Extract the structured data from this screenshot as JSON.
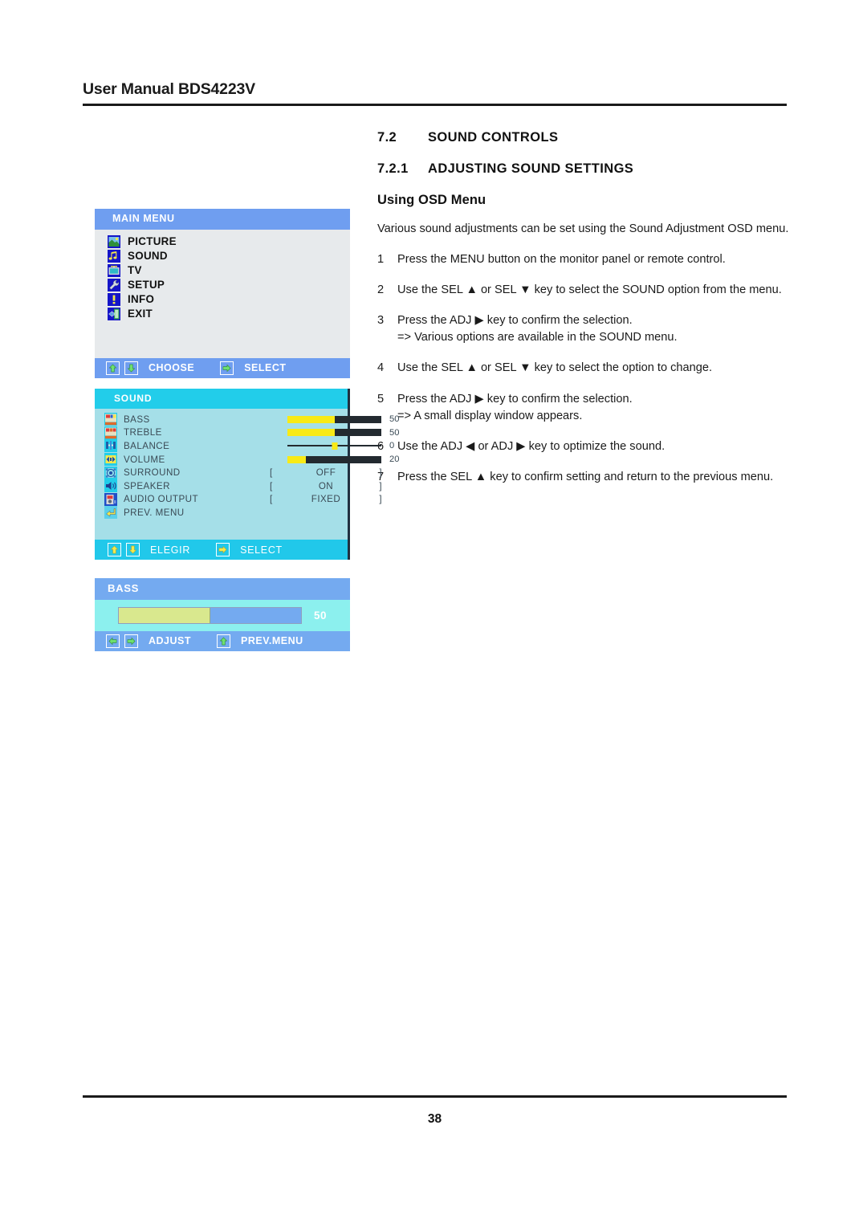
{
  "header": {
    "title": "User Manual BDS4223V"
  },
  "sections": {
    "s72_num": "7.2",
    "s72_title": "SOUND CONTROLS",
    "s721_num": "7.2.1",
    "s721_title": "ADJUSTING SOUND SETTINGS",
    "subhead": "Using OSD Menu",
    "intro": "Various sound adjustments can be set using the Sound Adjustment OSD menu."
  },
  "steps": [
    {
      "num": "1",
      "text": "Press the MENU button on the monitor panel or remote control.",
      "sub": ""
    },
    {
      "num": "2",
      "text": "Use the SEL ▲ or SEL ▼ key to select the SOUND option from the menu.",
      "sub": ""
    },
    {
      "num": "3",
      "text": "Press the ADJ ▶ key to confirm the selection.",
      "sub": "=> Various options are available in the SOUND menu."
    },
    {
      "num": "4",
      "text": "Use the SEL ▲ or SEL ▼ key to select the option to change.",
      "sub": ""
    },
    {
      "num": "5",
      "text": "Press the ADJ ▶ key to confirm the selection.",
      "sub": "=> A small display window appears."
    },
    {
      "num": "6",
      "text": "Use the ADJ ◀ or ADJ ▶  key to optimize the sound.",
      "sub": ""
    },
    {
      "num": "7",
      "text": "Press the SEL ▲ key to confirm setting and return to the previous menu.",
      "sub": ""
    }
  ],
  "main_menu": {
    "title": "MAIN  MENU",
    "items": [
      {
        "label": "PICTURE",
        "icon": "picture-icon"
      },
      {
        "label": "SOUND",
        "icon": "sound-icon"
      },
      {
        "label": "TV",
        "icon": "tv-icon"
      },
      {
        "label": "SETUP",
        "icon": "setup-wrench-icon"
      },
      {
        "label": "INFO",
        "icon": "info-icon"
      },
      {
        "label": "EXIT",
        "icon": "exit-icon"
      }
    ],
    "footer": {
      "choose": "CHOOSE",
      "select": "SELECT"
    }
  },
  "sound_menu": {
    "title": "SOUND",
    "rows": [
      {
        "label": "BASS",
        "icon": "bass-icon",
        "type": "bar",
        "value": "50",
        "percent": 50
      },
      {
        "label": "TREBLE",
        "icon": "treble-icon",
        "type": "bar",
        "value": "50",
        "percent": 50
      },
      {
        "label": "BALANCE",
        "icon": "balance-icon",
        "type": "line",
        "value": "0",
        "percent": 50
      },
      {
        "label": "VOLUME",
        "icon": "volume-icon",
        "type": "bar",
        "value": "20",
        "percent": 20
      },
      {
        "label": "SURROUND",
        "icon": "surround-icon",
        "type": "option",
        "value": "OFF"
      },
      {
        "label": "SPEAKER",
        "icon": "speaker-icon",
        "type": "option",
        "value": "ON"
      },
      {
        "label": "AUDIO OUTPUT",
        "icon": "audio-output-icon",
        "type": "option",
        "value": "FIXED"
      },
      {
        "label": "PREV. MENU",
        "icon": "prev-menu-icon",
        "type": "none",
        "value": ""
      }
    ],
    "bracket_left": "[",
    "bracket_right": "]",
    "footer": {
      "choose": "ELEGIR",
      "select": "SELECT"
    }
  },
  "bass_menu": {
    "title": "BASS",
    "value": "50",
    "percent": 50,
    "footer": {
      "adjust": "ADJUST",
      "prev": "PREV.MENU"
    }
  },
  "footer": {
    "page_number": "38"
  },
  "colors": {
    "mm_bar": "#6f9ef0",
    "mm_body": "#e7eaec",
    "sound_bar": "#22cdea",
    "sound_body": "#a5dfe8",
    "bass_bar": "#74aaf0",
    "bass_body": "#8cf0ee",
    "slider_yellow": "#f8ea16",
    "slider_track": "#232a30"
  }
}
